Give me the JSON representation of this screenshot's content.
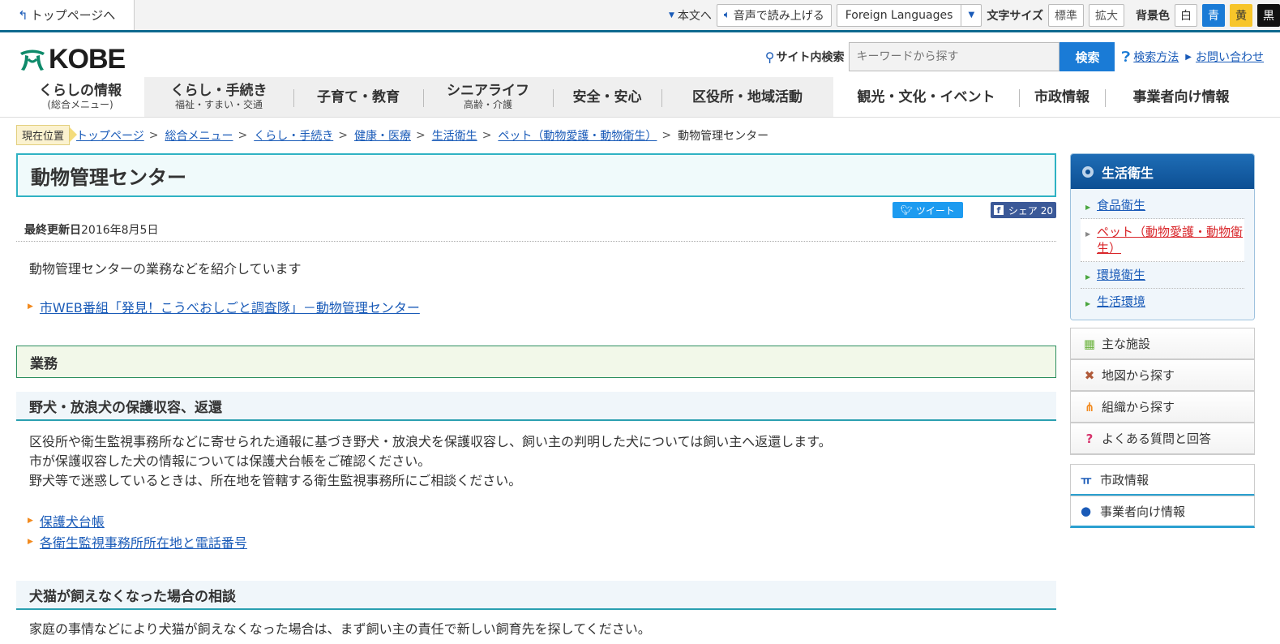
{
  "topbar": {
    "home_link": "トップページへ",
    "skip_link": "本文へ",
    "voice_button": "音声で読み上げる",
    "language_select": "Foreign Languages",
    "font_size_label": "文字サイズ",
    "font_standard": "標準",
    "font_large": "拡大",
    "bg_label": "背景色",
    "bg_white": "白",
    "bg_blue": "青",
    "bg_yellow": "黄",
    "bg_black": "黒"
  },
  "header": {
    "logo_text": "KOBE",
    "search_label": "サイト内検索",
    "search_placeholder": "キーワードから探す",
    "search_button": "検索",
    "search_help": "検索方法",
    "contact": "お問い合わせ"
  },
  "gnav": [
    {
      "main": "くらしの情報",
      "sub": "(総合メニュー)"
    },
    {
      "main": "くらし・手続き",
      "sub": "福祉・すまい・交通"
    },
    {
      "main": "子育て・教育",
      "sub": ""
    },
    {
      "main": "シニアライフ",
      "sub": "高齢・介護"
    },
    {
      "main": "安全・安心",
      "sub": ""
    },
    {
      "main": "区役所・地域活動",
      "sub": ""
    },
    {
      "main": "観光・文化・イベント",
      "sub": ""
    },
    {
      "main": "市政情報",
      "sub": ""
    },
    {
      "main": "事業者向け情報",
      "sub": ""
    }
  ],
  "breadcrumb": {
    "label": "現在位置",
    "items": [
      "トップページ",
      "総合メニュー",
      "くらし・手続き",
      "健康・医療",
      "生活衛生",
      "ペット（動物愛護・動物衛生）"
    ],
    "current": "動物管理センター"
  },
  "page": {
    "title": "動物管理センター",
    "tweet": "ツイート",
    "share": "シェア 20",
    "updated_label": "最終更新日",
    "updated_date": "2016年8月5日",
    "lead": "動物管理センターの業務などを紹介しています",
    "web_link": "市WEB番組「発見！こうべおしごと調査隊」－動物管理センター",
    "section_h2": "業務",
    "section1_title": "野犬・放浪犬の保護収容、返還",
    "section1_p1": "区役所や衛生監視事務所などに寄せられた通報に基づき野犬・放浪犬を保護収容し、飼い主の判明した犬については飼い主へ返還します。",
    "section1_p2": "市が保護収容した犬の情報については保護犬台帳をご確認ください。",
    "section1_p3": "野犬等で迷惑しているときは、所在地を管轄する衛生監視事務所にご相談ください。",
    "section1_link1": "保護犬台帳",
    "section1_link2": "各衛生監視事務所所在地と電話番号",
    "section2_title": "犬猫が飼えなくなった場合の相談",
    "section2_p1": "家庭の事情などにより犬猫が飼えなくなった場合は、まず飼い主の責任で新しい飼育先を探してください。"
  },
  "sidebar": {
    "heading": "生活衛生",
    "items": [
      "食品衛生",
      "ペット（動物愛護・動物衛生）",
      "環境衛生",
      "生活環境"
    ],
    "buttons": [
      "主な施設",
      "地図から探す",
      "組織から探す",
      "よくある質問と回答"
    ],
    "buttons2": [
      "市政情報",
      "事業者向け情報"
    ]
  }
}
